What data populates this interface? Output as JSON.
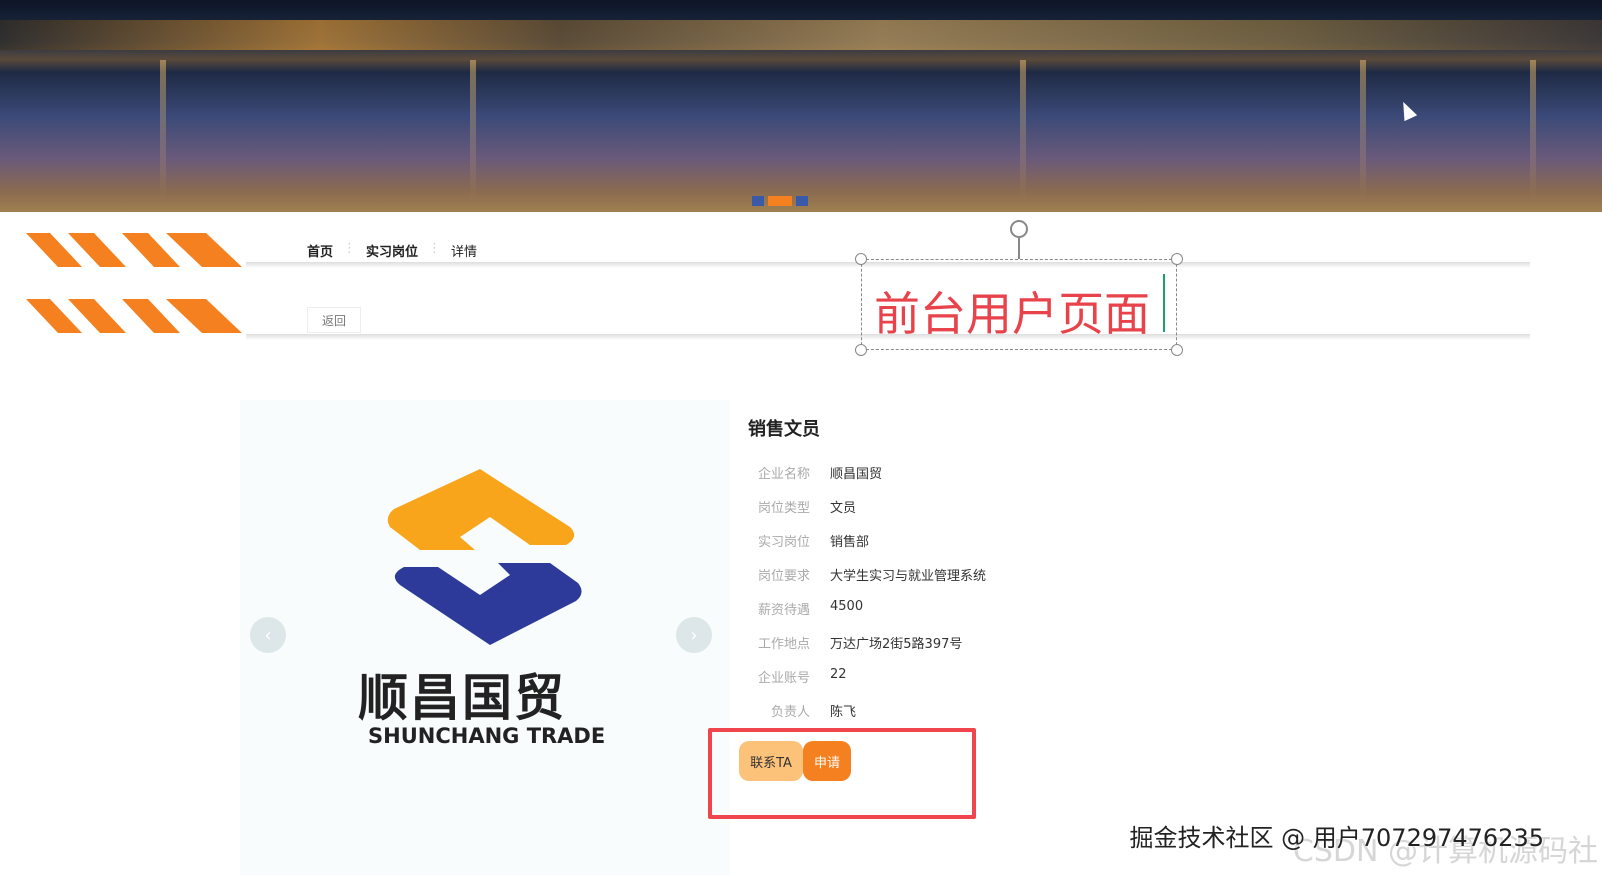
{
  "banner": {
    "slide_count": 3,
    "active_slide": 2
  },
  "breadcrumb": {
    "items": [
      "首页",
      "实习岗位",
      "详情"
    ],
    "separator": "⋮"
  },
  "back_label": "返回",
  "annotation": {
    "text": "前台用户页面",
    "color": "#e8434b"
  },
  "gallery": {
    "logo_cn": "顺昌国贸",
    "logo_en": "SHUNCHANG TRADE",
    "prev": "‹",
    "next": "›"
  },
  "job": {
    "title": "销售文员",
    "fields": [
      {
        "label": "企业名称",
        "value": "顺昌国贸"
      },
      {
        "label": "岗位类型",
        "value": "文员"
      },
      {
        "label": "实习岗位",
        "value": "销售部"
      },
      {
        "label": "岗位要求",
        "value": "大学生实习与就业管理系统"
      },
      {
        "label": "薪资待遇",
        "value": "4500"
      },
      {
        "label": "工作地点",
        "value": "万达广场2街5路397号"
      },
      {
        "label": "企业账号",
        "value": "22"
      },
      {
        "label": "负责人",
        "value": "陈飞"
      }
    ]
  },
  "actions": {
    "contact": "联系TA",
    "apply": "申请"
  },
  "colors": {
    "accent": "#f5801f",
    "contact_bg": "#fcc27a",
    "highlight": "#f0454d"
  },
  "watermark": {
    "main": "掘金技术社区 @ 用户707297476235",
    "secondary": "CSDN @计算机源码社"
  }
}
